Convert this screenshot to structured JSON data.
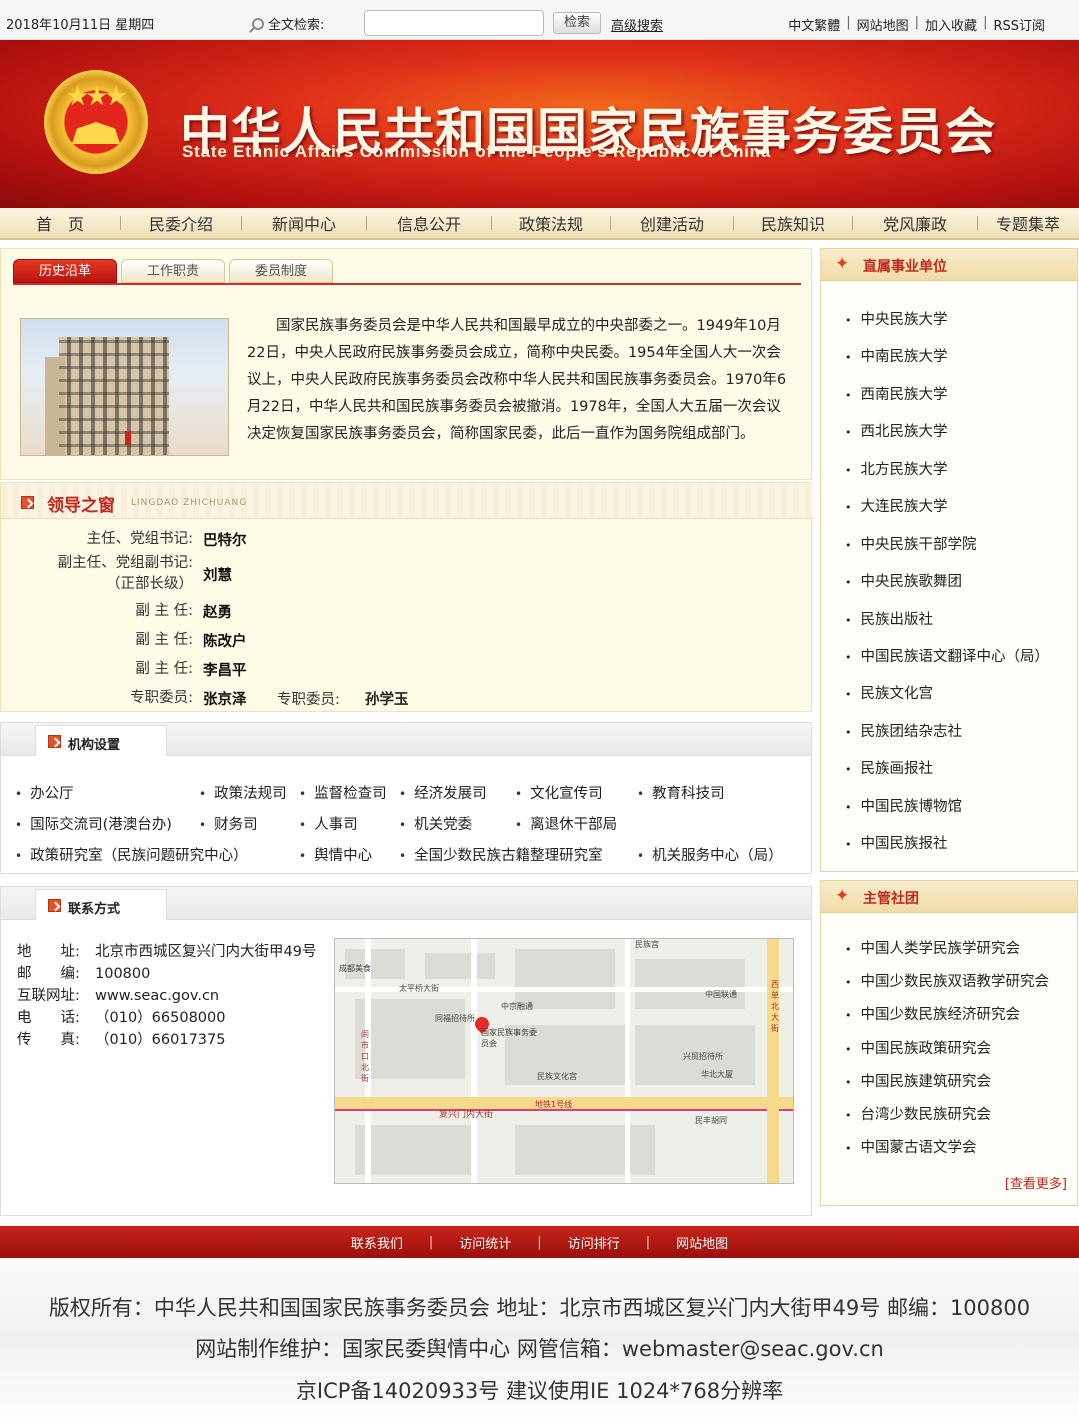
{
  "topbar": {
    "date": "2018年10月11日 星期四",
    "search_label": "全文检索:",
    "search_value": "",
    "search_button": "检索",
    "advanced": "高级搜索",
    "links": [
      "中文繁體",
      "网站地图",
      "加入收藏",
      "RSS订阅"
    ]
  },
  "banner": {
    "cn_title": "中华人民共和国国家民族事务委员会",
    "en_title": "State Ethnic Affairs Commission of the People's Republic of China"
  },
  "nav": [
    "首　页",
    "民委介绍",
    "新闻中心",
    "信息公开",
    "政策法规",
    "创建活动",
    "民族知识",
    "党风廉政",
    "专题集萃"
  ],
  "about": {
    "tabs": [
      "历史沿革",
      "工作职责",
      "委员制度"
    ],
    "intro": "国家民族事务委员会是中华人民共和国最早成立的中央部委之一。1949年10月22日，中央人民政府民族事务委员会成立，简称中央民委。1954年全国人大一次会议上，中央人民政府民族事务委员会改称中华人民共和国民族事务委员会。1970年6月22日，中华人民共和国民族事务委员会被撤消。1978年，全国人大五届一次会议决定恢复国家民族事务委员会，简称国家民委，此后一直作为国务院组成部门。"
  },
  "leaders": {
    "title": "领导之窗",
    "subtitle": "LINGDAO ZHICHUANG",
    "rows": [
      {
        "role": "主任、党组书记:",
        "name": "巴特尔"
      },
      {
        "role": "副主任、党组副书记:\n（正部长级）",
        "name": "刘慧"
      },
      {
        "role": "副 主 任:",
        "name": "赵勇"
      },
      {
        "role": "副 主 任:",
        "name": "陈改户"
      },
      {
        "role": "副 主 任:",
        "name": "李昌平"
      },
      {
        "role": "专职委员:",
        "name": "张京泽"
      }
    ],
    "extra_role": "专职委员:",
    "extra_name": "孙学玉"
  },
  "org": {
    "title": "机构设置",
    "items": [
      "办公厅",
      "政策法规司",
      "监督检查司",
      "经济发展司",
      "文化宣传司",
      "教育科技司",
      "国际交流司(港澳台办)",
      "财务司",
      "人事司",
      "机关党委",
      "离退休干部局",
      "政策研究室（民族问题研究中心）",
      "舆情中心",
      "全国少数民族古籍整理研究室",
      "机关服务中心（局）"
    ]
  },
  "contact": {
    "title": "联系方式",
    "rows": [
      {
        "k": "地　　址:",
        "v": "北京市西城区复兴门内大街甲49号"
      },
      {
        "k": "邮　　编:",
        "v": "100800"
      },
      {
        "k": "互联网址:",
        "v": "www.seac.gov.cn"
      },
      {
        "k": "电　　话:",
        "v": "（010）66508000"
      },
      {
        "k": "传　　真:",
        "v": "（010）66017375"
      }
    ],
    "map_labels": [
      "太平桥大街",
      "国家民族事务委员会",
      "复兴门内大街",
      "西单北大街",
      "民族文化宫",
      "中京融通",
      "兴贸招待所",
      "民丰胡同",
      "地铁1号线",
      "中国联通",
      "闹市口北街",
      "华北大厦",
      "成都美食",
      "民族宫",
      "同福招待所"
    ]
  },
  "right": {
    "units_title": "直属事业单位",
    "units": [
      "中央民族大学",
      "中南民族大学",
      "西南民族大学",
      "西北民族大学",
      "北方民族大学",
      "大连民族大学",
      "中央民族干部学院",
      "中央民族歌舞团",
      "民族出版社",
      "中国民族语文翻译中心（局）",
      "民族文化宫",
      "民族团结杂志社",
      "民族画报社",
      "中国民族博物馆",
      "中国民族报社"
    ],
    "societies_title": "主管社团",
    "societies": [
      "中国人类学民族学研究会",
      "中国少数民族双语教学研究会",
      "中国少数民族经济研究会",
      "中国民族政策研究会",
      "中国民族建筑研究会",
      "台湾少数民族研究会",
      "中国蒙古语文学会"
    ],
    "more": "[查看更多]"
  },
  "footer": {
    "links": [
      "联系我们",
      "访问统计",
      "访问排行",
      "网站地图"
    ],
    "line1": "版权所有：中华人民共和国国家民族事务委员会 地址：北京市西城区复兴门内大街甲49号 邮编：100800",
    "line2": "网站制作维护：国家民委舆情中心 网管信箱：webmaster@seac.gov.cn",
    "line3": "京ICP备14020933号 建议使用IE 1024*768分辨率"
  }
}
